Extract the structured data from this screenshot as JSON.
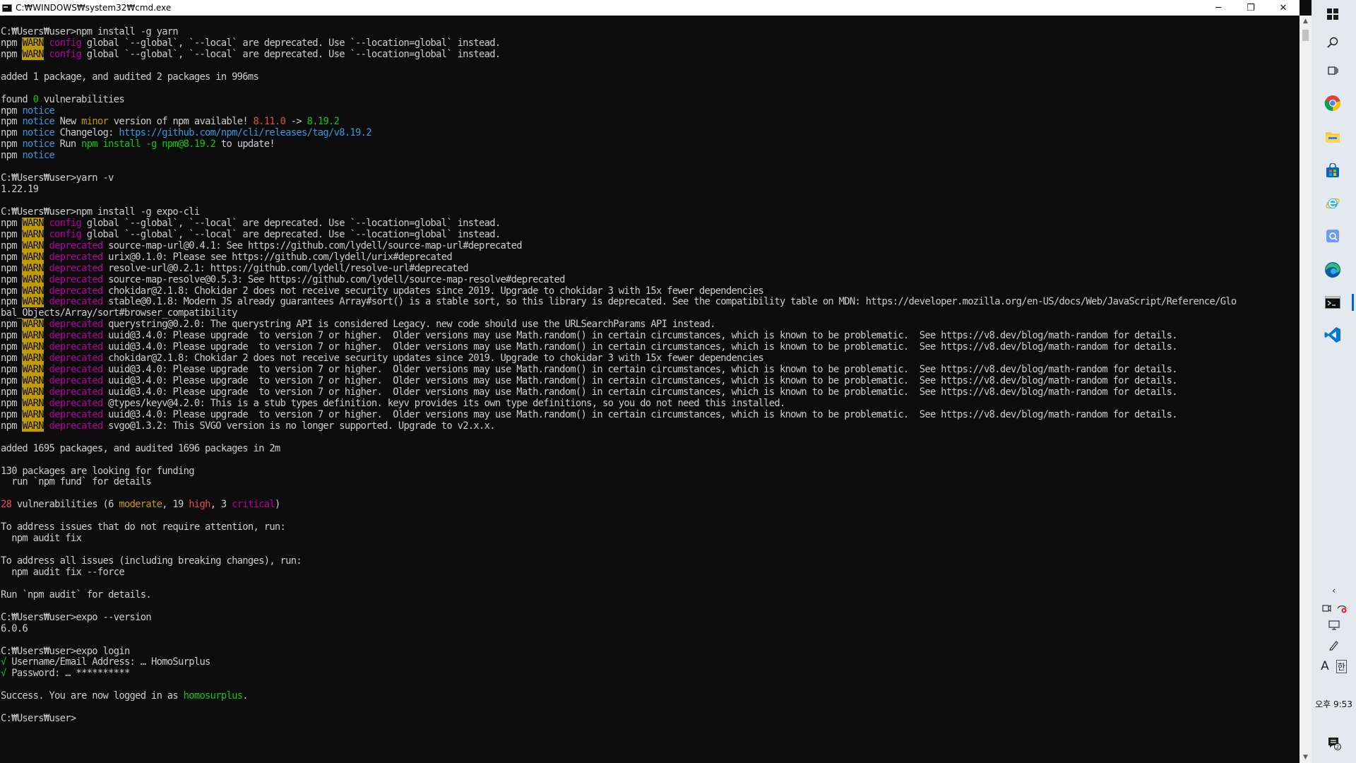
{
  "window": {
    "title": "C:₩WINDOWS₩system32₩cmd.exe",
    "minimize": "─",
    "restore": "❐",
    "close": "✕"
  },
  "colors": {
    "console_bg": "#0c0c0c",
    "console_fg": "#cccccc",
    "warn_bg": "#c19c00",
    "magenta": "#b4009e",
    "cyan": "#3a96dd",
    "yellow": "#c19c00",
    "red": "#e74856",
    "green": "#16c60c",
    "taskbar_bg": "#e4e8ef",
    "accent": "#0067c0"
  },
  "console": {
    "lines": [
      [
        {
          "t": ""
        }
      ],
      [
        {
          "t": "C:₩Users₩user>npm install -g yarn"
        }
      ],
      [
        {
          "t": "npm "
        },
        {
          "t": "WARN",
          "c": "warn"
        },
        {
          "t": " "
        },
        {
          "t": "config",
          "c": "mag"
        },
        {
          "t": " global `--global`, `--local` are deprecated. Use `--location=global` instead."
        }
      ],
      [
        {
          "t": "npm "
        },
        {
          "t": "WARN",
          "c": "warn"
        },
        {
          "t": " "
        },
        {
          "t": "config",
          "c": "mag"
        },
        {
          "t": " global `--global`, `--local` are deprecated. Use `--location=global` instead."
        }
      ],
      [
        {
          "t": ""
        }
      ],
      [
        {
          "t": "added 1 package, and audited 2 packages in 996ms"
        }
      ],
      [
        {
          "t": ""
        }
      ],
      [
        {
          "t": "found "
        },
        {
          "t": "0",
          "c": "grn"
        },
        {
          "t": " vulnerabilities"
        }
      ],
      [
        {
          "t": "npm "
        },
        {
          "t": "notice",
          "c": "cyan"
        }
      ],
      [
        {
          "t": "npm "
        },
        {
          "t": "notice",
          "c": "cyan"
        },
        {
          "t": " New "
        },
        {
          "t": "minor",
          "c": "yel"
        },
        {
          "t": " version of npm available! "
        },
        {
          "t": "8.11.0",
          "c": "red"
        },
        {
          "t": " -> "
        },
        {
          "t": "8.19.2",
          "c": "grn"
        }
      ],
      [
        {
          "t": "npm "
        },
        {
          "t": "notice",
          "c": "cyan"
        },
        {
          "t": " Changelog: "
        },
        {
          "t": "https://github.com/npm/cli/releases/tag/v8.19.2",
          "c": "cyan"
        }
      ],
      [
        {
          "t": "npm "
        },
        {
          "t": "notice",
          "c": "cyan"
        },
        {
          "t": " Run "
        },
        {
          "t": "npm install -g npm@8.19.2",
          "c": "grn"
        },
        {
          "t": " to update!"
        }
      ],
      [
        {
          "t": "npm "
        },
        {
          "t": "notice",
          "c": "cyan"
        }
      ],
      [
        {
          "t": ""
        }
      ],
      [
        {
          "t": "C:₩Users₩user>yarn -v"
        }
      ],
      [
        {
          "t": "1.22.19"
        }
      ],
      [
        {
          "t": ""
        }
      ],
      [
        {
          "t": "C:₩Users₩user>npm install -g expo-cli"
        }
      ],
      [
        {
          "t": "npm "
        },
        {
          "t": "WARN",
          "c": "warn"
        },
        {
          "t": " "
        },
        {
          "t": "config",
          "c": "mag"
        },
        {
          "t": " global `--global`, `--local` are deprecated. Use `--location=global` instead."
        }
      ],
      [
        {
          "t": "npm "
        },
        {
          "t": "WARN",
          "c": "warn"
        },
        {
          "t": " "
        },
        {
          "t": "config",
          "c": "mag"
        },
        {
          "t": " global `--global`, `--local` are deprecated. Use `--location=global` instead."
        }
      ],
      [
        {
          "t": "npm "
        },
        {
          "t": "WARN",
          "c": "warn"
        },
        {
          "t": " "
        },
        {
          "t": "deprecated",
          "c": "mag"
        },
        {
          "t": " source-map-url@0.4.1: See https://github.com/lydell/source-map-url#deprecated"
        }
      ],
      [
        {
          "t": "npm "
        },
        {
          "t": "WARN",
          "c": "warn"
        },
        {
          "t": " "
        },
        {
          "t": "deprecated",
          "c": "mag"
        },
        {
          "t": " urix@0.1.0: Please see https://github.com/lydell/urix#deprecated"
        }
      ],
      [
        {
          "t": "npm "
        },
        {
          "t": "WARN",
          "c": "warn"
        },
        {
          "t": " "
        },
        {
          "t": "deprecated",
          "c": "mag"
        },
        {
          "t": " resolve-url@0.2.1: https://github.com/lydell/resolve-url#deprecated"
        }
      ],
      [
        {
          "t": "npm "
        },
        {
          "t": "WARN",
          "c": "warn"
        },
        {
          "t": " "
        },
        {
          "t": "deprecated",
          "c": "mag"
        },
        {
          "t": " source-map-resolve@0.5.3: See https://github.com/lydell/source-map-resolve#deprecated"
        }
      ],
      [
        {
          "t": "npm "
        },
        {
          "t": "WARN",
          "c": "warn"
        },
        {
          "t": " "
        },
        {
          "t": "deprecated",
          "c": "mag"
        },
        {
          "t": " chokidar@2.1.8: Chokidar 2 does not receive security updates since 2019. Upgrade to chokidar 3 with 15x fewer dependencies"
        }
      ],
      [
        {
          "t": "npm "
        },
        {
          "t": "WARN",
          "c": "warn"
        },
        {
          "t": " "
        },
        {
          "t": "deprecated",
          "c": "mag"
        },
        {
          "t": " stable@0.1.8: Modern JS already guarantees Array#sort() is a stable sort, so this library is deprecated. See the compatibility table on MDN: https://developer.mozilla.org/en-US/docs/Web/JavaScript/Reference/Glo"
        }
      ],
      [
        {
          "t": "bal_Objects/Array/sort#browser_compatibility"
        }
      ],
      [
        {
          "t": "npm "
        },
        {
          "t": "WARN",
          "c": "warn"
        },
        {
          "t": " "
        },
        {
          "t": "deprecated",
          "c": "mag"
        },
        {
          "t": " querystring@0.2.0: The querystring API is considered Legacy. new code should use the URLSearchParams API instead."
        }
      ],
      [
        {
          "t": "npm "
        },
        {
          "t": "WARN",
          "c": "warn"
        },
        {
          "t": " "
        },
        {
          "t": "deprecated",
          "c": "mag"
        },
        {
          "t": " uuid@3.4.0: Please upgrade  to version 7 or higher.  Older versions may use Math.random() in certain circumstances, which is known to be problematic.  See https://v8.dev/blog/math-random for details."
        }
      ],
      [
        {
          "t": "npm "
        },
        {
          "t": "WARN",
          "c": "warn"
        },
        {
          "t": " "
        },
        {
          "t": "deprecated",
          "c": "mag"
        },
        {
          "t": " uuid@3.4.0: Please upgrade  to version 7 or higher.  Older versions may use Math.random() in certain circumstances, which is known to be problematic.  See https://v8.dev/blog/math-random for details."
        }
      ],
      [
        {
          "t": "npm "
        },
        {
          "t": "WARN",
          "c": "warn"
        },
        {
          "t": " "
        },
        {
          "t": "deprecated",
          "c": "mag"
        },
        {
          "t": " chokidar@2.1.8: Chokidar 2 does not receive security updates since 2019. Upgrade to chokidar 3 with 15x fewer dependencies"
        }
      ],
      [
        {
          "t": "npm "
        },
        {
          "t": "WARN",
          "c": "warn"
        },
        {
          "t": " "
        },
        {
          "t": "deprecated",
          "c": "mag"
        },
        {
          "t": " uuid@3.4.0: Please upgrade  to version 7 or higher.  Older versions may use Math.random() in certain circumstances, which is known to be problematic.  See https://v8.dev/blog/math-random for details."
        }
      ],
      [
        {
          "t": "npm "
        },
        {
          "t": "WARN",
          "c": "warn"
        },
        {
          "t": " "
        },
        {
          "t": "deprecated",
          "c": "mag"
        },
        {
          "t": " uuid@3.4.0: Please upgrade  to version 7 or higher.  Older versions may use Math.random() in certain circumstances, which is known to be problematic.  See https://v8.dev/blog/math-random for details."
        }
      ],
      [
        {
          "t": "npm "
        },
        {
          "t": "WARN",
          "c": "warn"
        },
        {
          "t": " "
        },
        {
          "t": "deprecated",
          "c": "mag"
        },
        {
          "t": " uuid@3.4.0: Please upgrade  to version 7 or higher.  Older versions may use Math.random() in certain circumstances, which is known to be problematic.  See https://v8.dev/blog/math-random for details."
        }
      ],
      [
        {
          "t": "npm "
        },
        {
          "t": "WARN",
          "c": "warn"
        },
        {
          "t": " "
        },
        {
          "t": "deprecated",
          "c": "mag"
        },
        {
          "t": " @types/keyv@4.2.0: This is a stub types definition. keyv provides its own type definitions, so you do not need this installed."
        }
      ],
      [
        {
          "t": "npm "
        },
        {
          "t": "WARN",
          "c": "warn"
        },
        {
          "t": " "
        },
        {
          "t": "deprecated",
          "c": "mag"
        },
        {
          "t": " uuid@3.4.0: Please upgrade  to version 7 or higher.  Older versions may use Math.random() in certain circumstances, which is known to be problematic.  See https://v8.dev/blog/math-random for details."
        }
      ],
      [
        {
          "t": "npm "
        },
        {
          "t": "WARN",
          "c": "warn"
        },
        {
          "t": " "
        },
        {
          "t": "deprecated",
          "c": "mag"
        },
        {
          "t": " svgo@1.3.2: This SVGO version is no longer supported. Upgrade to v2.x.x."
        }
      ],
      [
        {
          "t": ""
        }
      ],
      [
        {
          "t": "added 1695 packages, and audited 1696 packages in 2m"
        }
      ],
      [
        {
          "t": ""
        }
      ],
      [
        {
          "t": "130 packages are looking for funding"
        }
      ],
      [
        {
          "t": "  run `npm fund` for details"
        }
      ],
      [
        {
          "t": ""
        }
      ],
      [
        {
          "t": "28",
          "c": "red"
        },
        {
          "t": " vulnerabilities (6 "
        },
        {
          "t": "moderate",
          "c": "yel"
        },
        {
          "t": ", 19 "
        },
        {
          "t": "high",
          "c": "red"
        },
        {
          "t": ", 3 "
        },
        {
          "t": "critical",
          "c": "mag"
        },
        {
          "t": ")"
        }
      ],
      [
        {
          "t": ""
        }
      ],
      [
        {
          "t": "To address issues that do not require attention, run:"
        }
      ],
      [
        {
          "t": "  npm audit fix"
        }
      ],
      [
        {
          "t": ""
        }
      ],
      [
        {
          "t": "To address all issues (including breaking changes), run:"
        }
      ],
      [
        {
          "t": "  npm audit fix --force"
        }
      ],
      [
        {
          "t": ""
        }
      ],
      [
        {
          "t": "Run `npm audit` for details."
        }
      ],
      [
        {
          "t": ""
        }
      ],
      [
        {
          "t": "C:₩Users₩user>expo --version"
        }
      ],
      [
        {
          "t": "6.0.6"
        }
      ],
      [
        {
          "t": ""
        }
      ],
      [
        {
          "t": "C:₩Users₩user>expo login"
        }
      ],
      [
        {
          "t": "√",
          "c": "grn"
        },
        {
          "t": " Username/Email Address: … HomoSurplus"
        }
      ],
      [
        {
          "t": "√",
          "c": "grn"
        },
        {
          "t": " Password: … **********"
        }
      ],
      [
        {
          "t": ""
        }
      ],
      [
        {
          "t": "Success. You are now logged in as "
        },
        {
          "t": "homosurplus",
          "c": "grn"
        },
        {
          "t": "."
        }
      ],
      [
        {
          "t": ""
        }
      ],
      [
        {
          "t": "C:₩Users₩user>"
        }
      ]
    ]
  },
  "taskbar": {
    "items": [
      {
        "name": "start-button",
        "icon": "windows-logo-icon"
      },
      {
        "name": "search-button",
        "icon": "search-icon"
      },
      {
        "name": "task-view-button",
        "icon": "task-view-icon"
      },
      {
        "name": "chrome-app",
        "icon": "chrome-icon"
      },
      {
        "name": "file-explorer-app",
        "icon": "folder-icon"
      },
      {
        "name": "microsoft-store-app",
        "icon": "store-icon"
      },
      {
        "name": "internet-explorer-app",
        "icon": "ie-icon"
      },
      {
        "name": "snipping-app",
        "icon": "snip-icon"
      },
      {
        "name": "edge-app",
        "icon": "edge-icon"
      },
      {
        "name": "cmd-app",
        "icon": "terminal-icon"
      },
      {
        "name": "vscode-app",
        "icon": "vscode-icon"
      }
    ],
    "ime_label": "A",
    "ime_lang": "한",
    "clock": "오후 9:53",
    "notification_count": "2"
  }
}
